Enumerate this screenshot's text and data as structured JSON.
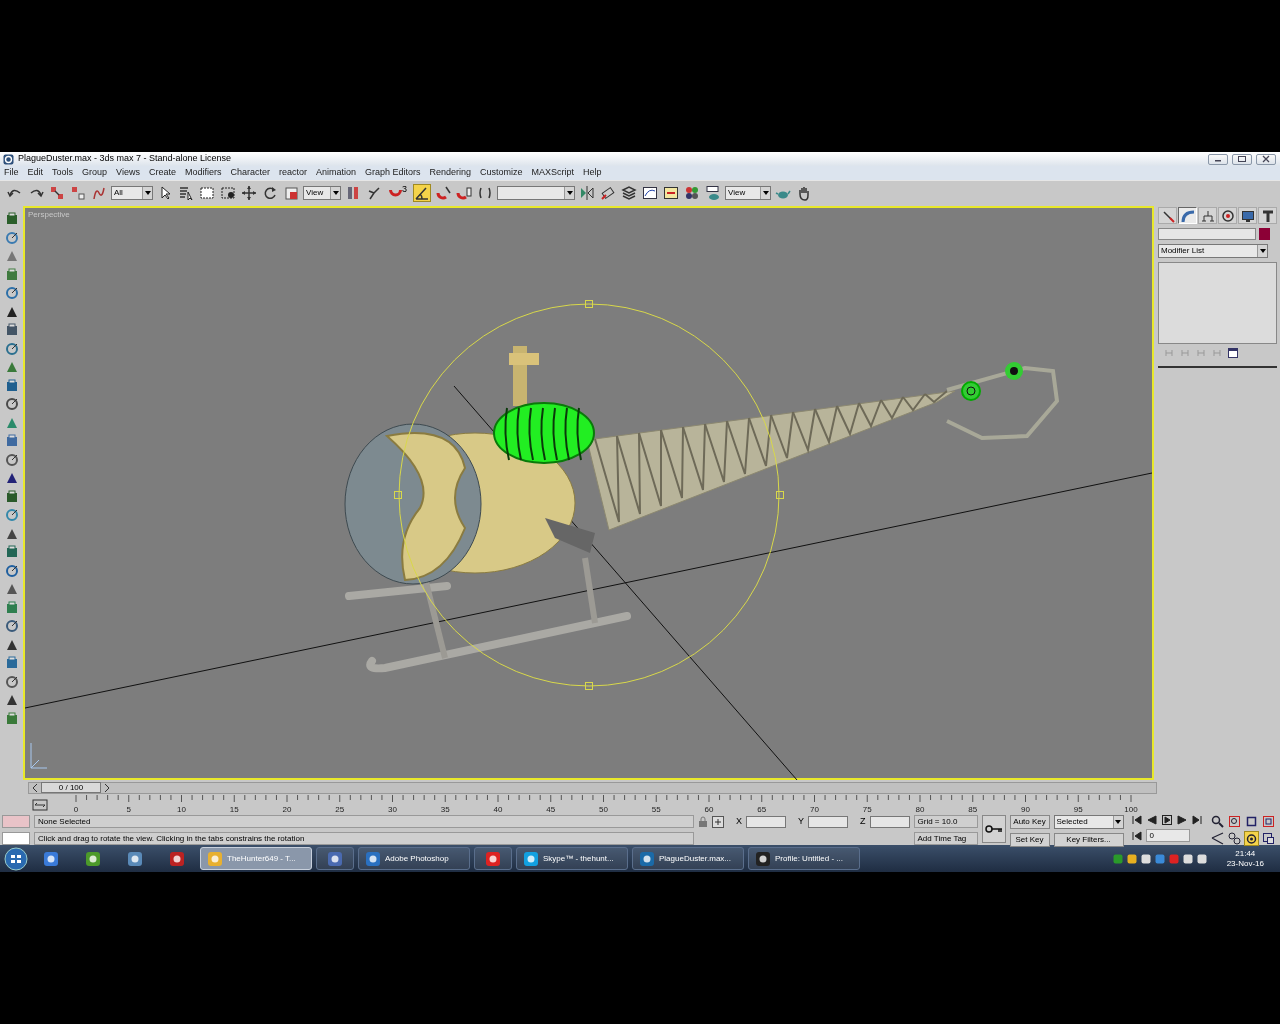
{
  "window": {
    "title": "PlagueDuster.max - 3ds max 7  - Stand-alone License"
  },
  "menu": [
    "File",
    "Edit",
    "Tools",
    "Group",
    "Views",
    "Create",
    "Modifiers",
    "Character",
    "reactor",
    "Animation",
    "Graph Editors",
    "Rendering",
    "Customize",
    "MAXScript",
    "Help"
  ],
  "toolbar": {
    "selection_filter": "All",
    "reference_coord": "View",
    "snap_dimension": "3",
    "render_view": "View",
    "angle_snap_on": true
  },
  "viewport": {
    "label": "Perspective"
  },
  "command_panel": {
    "tabs": [
      {
        "selected": false
      },
      {
        "selected": true
      },
      {
        "selected": false
      },
      {
        "selected": false
      },
      {
        "selected": false
      },
      {
        "selected": false
      }
    ],
    "modifier_list": "Modifier List"
  },
  "timeline": {
    "frame_slider": "0 / 100",
    "ticks": [
      "0",
      "5",
      "10",
      "15",
      "20",
      "25",
      "30",
      "35",
      "40",
      "45",
      "50",
      "55",
      "60",
      "65",
      "70",
      "75",
      "80",
      "85",
      "90",
      "95",
      "100"
    ]
  },
  "status": {
    "selection": "None Selected",
    "prompt": "Click and drag to rotate the view.  Clicking in the tabs constrains the rotation",
    "x_label": "X",
    "y_label": "Y",
    "z_label": "Z",
    "grid": "Grid = 10.0",
    "time_tag": "Add Time Tag",
    "auto_key": "Auto Key",
    "set_key": "Set Key",
    "key_mode": "Selected",
    "key_filters": "Key Filters...",
    "current_frame": "0",
    "arc_rotate_on": true
  },
  "taskbar": {
    "items": [
      {
        "kind": "pinned"
      },
      {
        "kind": "pinned"
      },
      {
        "kind": "pinned"
      },
      {
        "kind": "pinned"
      },
      {
        "kind": "window",
        "label": "TheHunter649 - T...",
        "selected": true
      },
      {
        "kind": "window",
        "selected": false
      },
      {
        "kind": "window",
        "label": "Adobe Photoshop",
        "selected": false
      },
      {
        "kind": "window",
        "selected": false
      },
      {
        "kind": "window",
        "label": "Skype™ - thehunt...",
        "selected": false
      },
      {
        "kind": "window",
        "label": "PlagueDuster.max...",
        "selected": false
      },
      {
        "kind": "window",
        "label": "Profile: Untitled - ...",
        "selected": false
      }
    ],
    "time": "21:44",
    "date": "23-Nov-16"
  }
}
